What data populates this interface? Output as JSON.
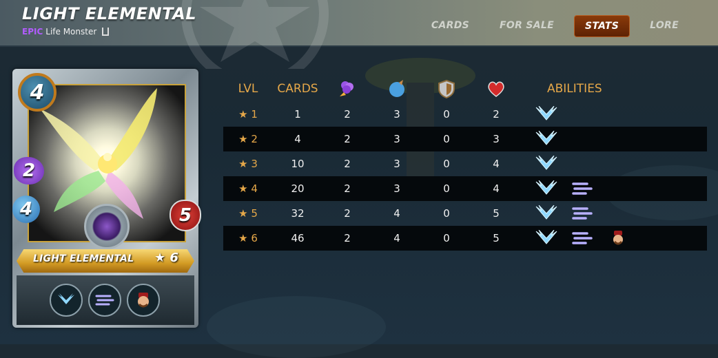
{
  "header": {
    "title": "LIGHT ELEMENTAL",
    "rarity": "EPIC",
    "type_line": "Life Monster",
    "tabs": [
      {
        "label": "CARDS",
        "active": false
      },
      {
        "label": "FOR SALE",
        "active": false
      },
      {
        "label": "STATS",
        "active": true
      },
      {
        "label": "LORE",
        "active": false
      }
    ]
  },
  "card": {
    "name": "LIGHT ELEMENTAL",
    "mana": "4",
    "magic": "2",
    "speed": "4",
    "health": "5",
    "level": "★ 6",
    "abilities": [
      "wings-icon",
      "wind-lines-icon",
      "character-face-icon"
    ]
  },
  "stats_table": {
    "headers": {
      "lvl": "LVL",
      "cards": "CARDS",
      "magic_icon": "magic-attack-icon",
      "speed_icon": "speed-icon",
      "armor_icon": "armor-shield-icon",
      "health_icon": "health-heart-icon",
      "abilities": "ABILITIES"
    },
    "rows": [
      {
        "star": "★",
        "lvl": "1",
        "cards": "1",
        "magic": "2",
        "speed": "3",
        "armor": "0",
        "health": "2",
        "abilities": [
          "wings-icon"
        ]
      },
      {
        "star": "★",
        "lvl": "2",
        "cards": "4",
        "magic": "2",
        "speed": "3",
        "armor": "0",
        "health": "3",
        "abilities": [
          "wings-icon"
        ]
      },
      {
        "star": "★",
        "lvl": "3",
        "cards": "10",
        "magic": "2",
        "speed": "3",
        "armor": "0",
        "health": "4",
        "abilities": [
          "wings-icon"
        ]
      },
      {
        "star": "★",
        "lvl": "4",
        "cards": "20",
        "magic": "2",
        "speed": "3",
        "armor": "0",
        "health": "4",
        "abilities": [
          "wings-icon",
          "wind-lines-icon"
        ]
      },
      {
        "star": "★",
        "lvl": "5",
        "cards": "32",
        "magic": "2",
        "speed": "4",
        "armor": "0",
        "health": "5",
        "abilities": [
          "wings-icon",
          "wind-lines-icon"
        ]
      },
      {
        "star": "★",
        "lvl": "6",
        "cards": "46",
        "magic": "2",
        "speed": "4",
        "armor": "0",
        "health": "5",
        "abilities": [
          "wings-icon",
          "wind-lines-icon",
          "character-face-icon"
        ]
      }
    ]
  },
  "colors": {
    "accent_gold": "#e6a849",
    "rarity_purple": "#b25cff",
    "active_tab": "#8a3a0a"
  }
}
